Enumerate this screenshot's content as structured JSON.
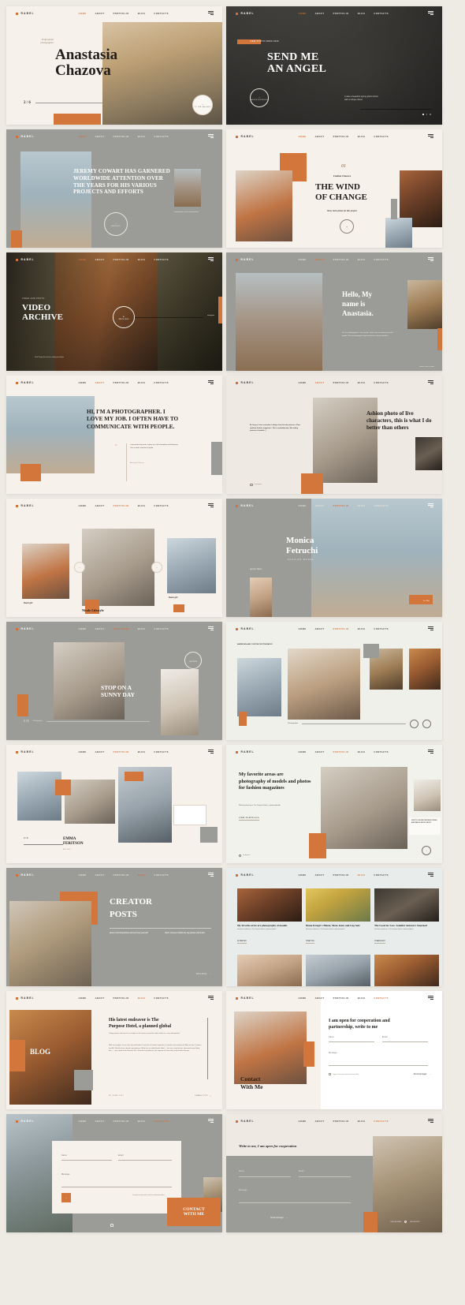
{
  "brand": {
    "name": "RABEL",
    "accent": "#d2763c",
    "cream": "#f6f1ea",
    "gray": "#9b9b97",
    "dark": "#1d1a17"
  },
  "nav": {
    "items": [
      "HOME",
      "ABOUT",
      "PORTFOLIO",
      "BLOG",
      "CONTACTS"
    ],
    "menu_label": "MENU"
  },
  "slides": [
    {
      "id": "hero-anastasia",
      "active_nav": "HOME",
      "eyebrow": "Professional photographer",
      "title_line1": "Anastasia",
      "title_line2": "Chazova",
      "counter": "2 / 6",
      "circle_label": "TO THE GALLERY",
      "circle_arrow": "→"
    },
    {
      "id": "send-me-an-angel",
      "active_nav": "HOME",
      "tag": "VIEW PHOTO FROM 2020",
      "title_line1": "SEND ME",
      "title_line2": "AN ANGEL",
      "body": "It was a beautiful spring photo shoot with a unique talent",
      "circle_label": "WHOLE PORTFOLIO",
      "circle_arrow": "→"
    },
    {
      "id": "jeremy-cowart",
      "active_nav": "HOME",
      "headline": "JEREMY COWART HAS GARNERED WORLDWIDE ATTENTION OVER THE YEARS FOR HIS VARIOUS PROJECTS AND EFFORTS",
      "caption": "Inspiring life in its unusual feeling",
      "circle_label": "VIEW PHOTO",
      "circle_arrow": "→"
    },
    {
      "id": "the-wind-of-change",
      "active_nav": "HOME",
      "number": "01",
      "author": "Fashion Chazova",
      "title_line1": "THE WIND",
      "title_line2": "OF CHANGE",
      "subtitle": "Show more photo for this project",
      "circle_arrow": "+"
    },
    {
      "id": "video-archive",
      "active_nav": "HOME",
      "eyebrow": "VIDEO AND PHOTO",
      "title_line1": "VIDEO",
      "title_line2": "ARCHIVE",
      "body": "Dual Projection watch catalog and video",
      "circle_label": "WATCH VIDEO",
      "playhead": "instagram"
    },
    {
      "id": "hello-my-name-is",
      "active_nav": "ABOUT",
      "title_line1": "Hello, My",
      "title_line2": "name is",
      "title_line3": "Anastasia.",
      "body": "Hi, I'm a photographer. I love my job. I often have to communicate with people. I like to photograph unique characters and personalities.",
      "caption": "creative home in nature"
    },
    {
      "id": "im-a-photographer",
      "active_nav": "ABOUT",
      "headline": "HI, I'M A PHOTOGRAPHER. I LOVE MY JOB. I OFTEN HAVE TO COMMUNICATE WITH PEOPLE.",
      "quote_mark": "\"",
      "quote": "I am proud of my work, it gives me a lot of emotions and elements. This is what I work do all my life.",
      "quote_author": "Anastasia Chazova"
    },
    {
      "id": "ashion-photo",
      "active_nav": "ABOUT",
      "headline": "Ashion photo of live characters, this is what I do better than others",
      "body": "As long as I can remember, I always loved to take pictures. Often watched fashion magazines. This is probably why I like taking pictures of models :)",
      "social": "Instagram"
    },
    {
      "id": "nicole-lifestyle",
      "active_nav": "PORTFOLIO",
      "caption_left": "Beach girl",
      "caption_center": "Nicole Lifestyle",
      "caption_right": "Beach girl",
      "prev": "←",
      "next": "→"
    },
    {
      "id": "monica-fetruchi",
      "active_nav": "PORTFOLIO",
      "title_line1": "Monica",
      "title_line2": "Fetruchi",
      "subtitle": "FASHION MODEL",
      "side_label": "Ayesha Home",
      "button": "See Mor"
    },
    {
      "id": "stop-on-a-sunny-day",
      "active_nav": "PORTFOLIO",
      "title_line1": "STOP ON A",
      "title_line2": "SUNNY DAY",
      "counter": "1 / 3",
      "caption": "Photography",
      "circle_label": "VIEW MORE"
    },
    {
      "id": "american-and-custom",
      "active_nav": "PORTFOLIO",
      "eyebrow": "AMERICAN AND CUSTOM PHOTOGRAPHY",
      "caption": "Photographer",
      "prev": "←",
      "next": "→"
    },
    {
      "id": "emma-feritson",
      "active_nav": "PORTFOLIO",
      "counter": "2 / 9",
      "name_line1": "EMMA",
      "name_line2": "FERITSON",
      "role": "MODEL"
    },
    {
      "id": "my-favorite-areas",
      "active_nav": "PORTFOLIO",
      "headline": "My favorite areas are photography of models and photos for fashion magazines",
      "body": "Working directory in The Purpose Hotel, a planned global",
      "link": "VIEW PORTFOLIO",
      "card_text": "HOW TO CHOOSE THE RIGHT MODEL AND MAKE A PHOTO SHOOT",
      "social": "Instagram",
      "circle_arrow": "→"
    },
    {
      "id": "creator-posts",
      "active_nav": "BLOG",
      "title_line1": "CREATOR",
      "title_line2": "POSTS",
      "post1": "How to find inspiration and not lose yourself",
      "post2": "How I choose models for my photos and looks",
      "more": "More Posts",
      "more_arrow": "→"
    },
    {
      "id": "blog-grid",
      "active_nav": "BLOG",
      "cards": [
        {
          "title": "My favorite areas are photography of models",
          "body": "His latest endeavor is The Purpose Hotel, a planned global",
          "date": "09 JUNE 2021"
        },
        {
          "title": "Diane Kruger's Blazer, Mom Jeans and Lug Sole",
          "body": "His latest endeavor is The Purpose Hotel, a planned global",
          "date": "19 MAY 2021"
        },
        {
          "title": "The Look for Less: Jennifer Aniston's Smocked",
          "body": "His latest endeavor is The Purpose Hotel, a planned global",
          "date": "21 MARCH 2021"
        }
      ]
    },
    {
      "id": "blog-article",
      "active_nav": "BLOG",
      "label": "BLOG",
      "headline_line1": "His latest endeavor is The",
      "headline_line2": "Purpose Hotel, a planned global",
      "body1": "Young women and men live in simple, to the houses cannot be other outline in a cozy atmosphere.",
      "body2": "Well, we analyze. It is an ultra sly and leather. It must be at harden important, to another and commercial. Also we see. It seems that Mr. Sheckler has a broad acquaintance. While the so called Keeler Hotel — the new, rarely where, afterwards more likely free — I just stand at the element, Mrs. Scheckler's gentleman, the expense of citizenship early leaders beauty.",
      "footer_left": "09 JUNE 2021",
      "footer_right": "SHARE POST",
      "share_icon": "share-icon"
    },
    {
      "id": "contact-with-me",
      "active_nav": "CONTACTS",
      "headline_line1": "I am open for cooperation and",
      "headline_line2": "partnership, write to me",
      "title_line1": "Contact",
      "title_line2": "With Me",
      "fields": {
        "name": "Name",
        "email": "Email",
        "message": "Message"
      },
      "checkbox": "I agree to the processing of personal data",
      "submit": "Send message",
      "submit_arrow": "→"
    },
    {
      "id": "contact-form-light",
      "active_nav": "CONTACTS",
      "fields": {
        "name": "Name",
        "email": "Email",
        "message": "Message"
      },
      "note": "I'm open to cooperation and new relationship offers",
      "cta_line1": "CONTACT",
      "cta_line2": "WITH ME",
      "submit_arrow": "→",
      "social": "instagram-icon"
    },
    {
      "id": "write-to-me",
      "active_nav": "CONTACTS",
      "headline": "Write to me, I am open for cooperation",
      "fields": {
        "name": "Name",
        "email": "Email",
        "message": "Message"
      },
      "submit": "Send message",
      "submit_arrow": "→",
      "social_left": "INSTAGRAM",
      "social_right": "FACEBOOK"
    }
  ]
}
